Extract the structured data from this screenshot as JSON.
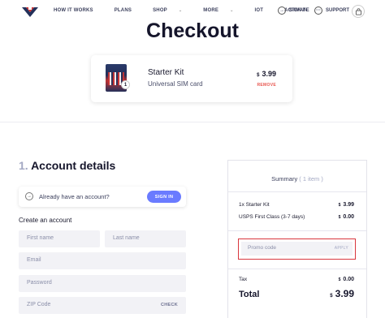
{
  "header": {
    "nav": [
      {
        "label": "HOW IT WORKS",
        "caret": false
      },
      {
        "label": "PLANS",
        "caret": false
      },
      {
        "label": "SHOP",
        "caret": true
      },
      {
        "label": "MORE",
        "caret": true
      },
      {
        "label": "IOT",
        "caret": false
      },
      {
        "label": "ACTIVATE",
        "caret": false
      }
    ],
    "signin_label": "SIGN IN",
    "support_label": "SUPPORT",
    "caret_glyph": "⌄"
  },
  "page_title": "Checkout",
  "product": {
    "name": "Starter Kit",
    "subtitle": "Universal SIM card",
    "currency": "$",
    "price": "3.99",
    "remove_label": "REMOVE",
    "quantity": "1"
  },
  "account": {
    "step_number": "1.",
    "heading": "Account details",
    "have_account_text": "Already have an account?",
    "signin_button": "SIGN IN",
    "create_heading": "Create an account",
    "first_name_placeholder": "First name",
    "last_name_placeholder": "Last name",
    "email_placeholder": "Email",
    "password_placeholder": "Password",
    "zip_placeholder": "ZIP Code",
    "check_label": "CHECK"
  },
  "summary": {
    "title": "Summary",
    "item_count": "( 1 item )",
    "rows": [
      {
        "label": "1x Starter Kit",
        "currency": "$",
        "value": "3.99"
      },
      {
        "label": "USPS First Class (3-7 days)",
        "currency": "$",
        "value": "0.00"
      }
    ],
    "promo_placeholder": "Promo code",
    "apply_label": "APPLY",
    "tax_label": "Tax",
    "tax_currency": "$",
    "tax_value": "0.00",
    "total_label": "Total",
    "total_currency": "$",
    "total_value": "3.99"
  },
  "colors": {
    "accent_button": "#6a7bff",
    "remove_text": "#e8554e",
    "promo_highlight": "#d9363e"
  }
}
